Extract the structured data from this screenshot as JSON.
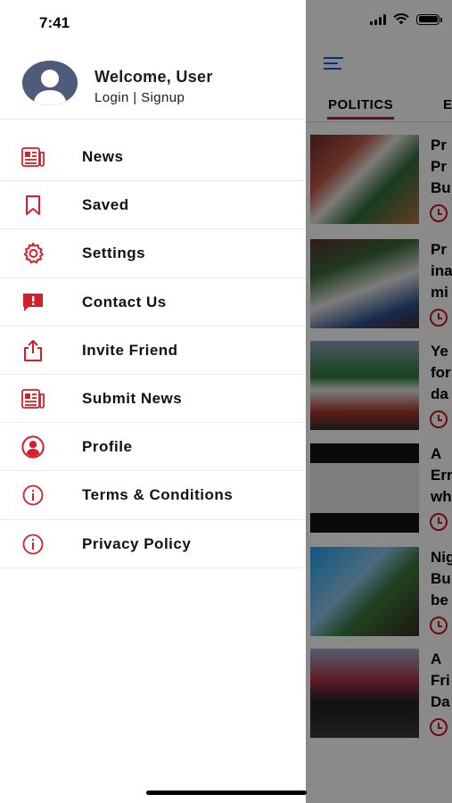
{
  "status_bar": {
    "time": "7:41"
  },
  "user": {
    "greeting": "Welcome, User",
    "auth_links": "Login | Signup"
  },
  "menu": [
    {
      "label": "News",
      "icon": "newspaper-icon"
    },
    {
      "label": "Saved",
      "icon": "bookmark-icon"
    },
    {
      "label": "Settings",
      "icon": "gear-icon"
    },
    {
      "label": "Contact Us",
      "icon": "message-alert-icon"
    },
    {
      "label": "Invite Friend",
      "icon": "share-icon"
    },
    {
      "label": "Submit News",
      "icon": "newspaper-icon"
    },
    {
      "label": "Profile",
      "icon": "user-circle-icon"
    },
    {
      "label": "Terms & Conditions",
      "icon": "info-icon"
    },
    {
      "label": "Privacy Policy",
      "icon": "info-icon"
    }
  ],
  "background": {
    "tabs": [
      {
        "label": "POLITICS"
      },
      {
        "label": "E"
      }
    ],
    "articles": [
      {
        "title": "Pr\nPr\nBu"
      },
      {
        "title": "Pr\nina\nmi"
      },
      {
        "title": "Ye\nfor\nda"
      },
      {
        "title": "A\nErr\nwh"
      },
      {
        "title": "Nig\nBu\nbe"
      },
      {
        "title": "A\nFri\nDa"
      }
    ]
  },
  "colors": {
    "accent_red": "#d3202a",
    "tab_underline": "#c8161e",
    "hamburger_blue": "#0b5cd8"
  }
}
